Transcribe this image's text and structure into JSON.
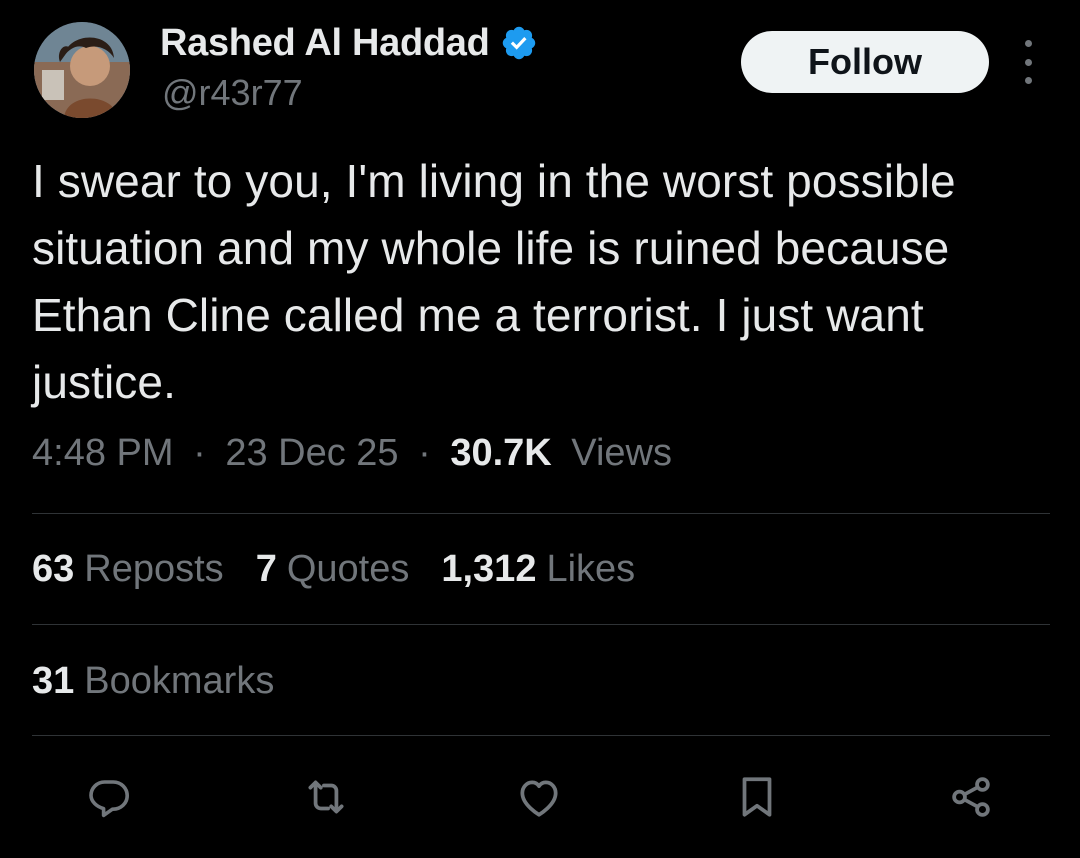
{
  "author": {
    "display_name": "Rashed Al Haddad",
    "handle": "@r43r77",
    "verified": true
  },
  "header": {
    "follow_label": "Follow"
  },
  "tweet": {
    "text": "I swear to you, I'm living in the worst possible situation and my whole life is ruined because Ethan Cline called me a terrorist. I just want justice.",
    "time": "4:48 PM",
    "date": "23 Dec 25",
    "views_count": "30.7K",
    "views_label": "Views",
    "separator": "·"
  },
  "stats": {
    "reposts_count": "63",
    "reposts_label": "Reposts",
    "quotes_count": "7",
    "quotes_label": "Quotes",
    "likes_count": "1,312",
    "likes_label": "Likes",
    "bookmarks_count": "31",
    "bookmarks_label": "Bookmarks"
  },
  "actions": [
    "reply-icon",
    "repost-icon",
    "like-icon",
    "bookmark-icon",
    "share-icon"
  ],
  "colors": {
    "background": "#000000",
    "primary_text": "#e7e9ea",
    "secondary_text": "#71767b",
    "divider": "#2f3336",
    "verified_blue": "#1d9bf0",
    "follow_button_bg": "#eff3f4"
  }
}
